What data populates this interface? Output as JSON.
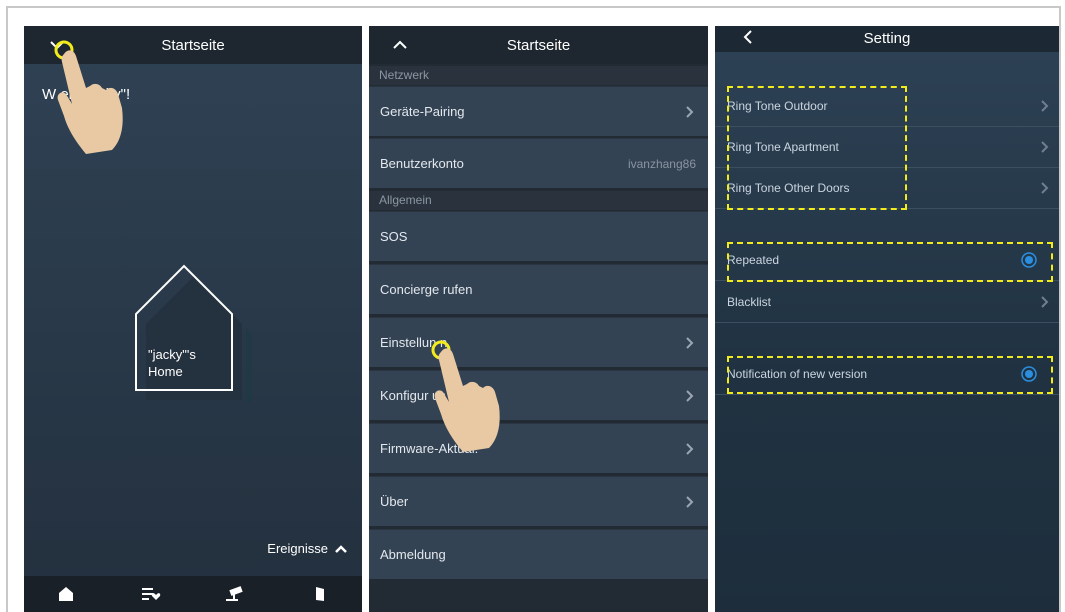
{
  "panel1": {
    "title": "Startseite",
    "welcome": "W    en \"jacky\"!",
    "house_label_line1": "\"jacky\"'s",
    "house_label_line2": "Home",
    "events_label": "Ereignisse",
    "tabs": [
      "home-icon",
      "list-heart-icon",
      "camera-icon",
      "door-icon"
    ]
  },
  "panel2": {
    "title": "Startseite",
    "sections": [
      {
        "header": "Netzwerk"
      },
      {
        "header": "Allgemein"
      }
    ],
    "rows": {
      "pairing": "Geräte-Pairing",
      "account": "Benutzerkonto",
      "account_value": "ivanzhang86",
      "sos": "SOS",
      "concierge": "Concierge rufen",
      "settings": "Einstellun  n",
      "config": "Konfigur               us",
      "firmware": "Firmware-Aktual.",
      "about": "Über",
      "logout": "Abmeldung"
    }
  },
  "panel3": {
    "title": "Setting",
    "rows": {
      "ring_outdoor": "Ring Tone Outdoor",
      "ring_apartment": "Ring Tone Apartment",
      "ring_other": "Ring Tone Other Doors",
      "repeated": "Repeated",
      "blacklist": "Blacklist",
      "notification": "Notification of new version"
    }
  },
  "colors": {
    "highlight": "#f3ec1d",
    "radio_blue": "#2a8fe0"
  }
}
